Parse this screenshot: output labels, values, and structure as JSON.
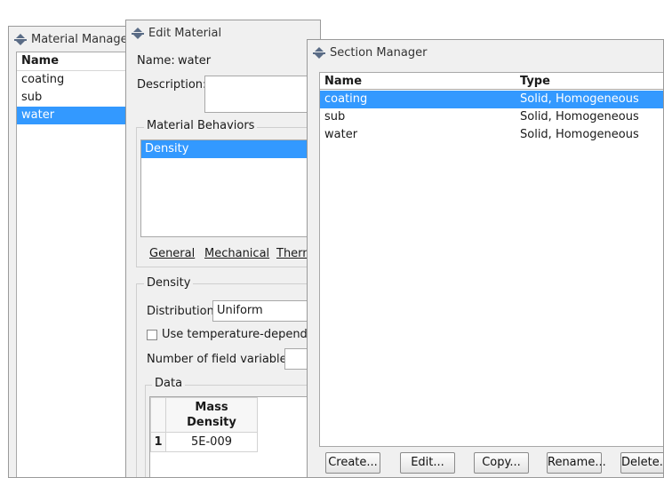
{
  "material_manager": {
    "title": "Material Manager",
    "column_name": "Name",
    "items": [
      "coating",
      "sub",
      "water"
    ],
    "selected": "water"
  },
  "edit_material": {
    "title": "Edit Material",
    "name_label": "Name:",
    "name_value": "water",
    "description_label": "Description:",
    "behaviors_group": "Material Behaviors",
    "behaviors": [
      "Density"
    ],
    "menu_tabs": [
      "General",
      "Mechanical",
      "Therm"
    ],
    "density_group": "Density",
    "distribution_label": "Distribution:",
    "distribution_value": "Uniform",
    "temp_dependent_label": "Use temperature-dependent",
    "field_vars_label": "Number of field variables:",
    "data_group": "Data",
    "table": {
      "header_line1": "Mass",
      "header_line2": "Density",
      "rows": [
        {
          "index": "1",
          "value": "5E-009"
        }
      ]
    }
  },
  "section_manager": {
    "title": "Section Manager",
    "col_name": "Name",
    "col_type": "Type",
    "rows": [
      {
        "name": "coating",
        "type": "Solid, Homogeneous"
      },
      {
        "name": "sub",
        "type": "Solid, Homogeneous"
      },
      {
        "name": "water",
        "type": "Solid, Homogeneous"
      }
    ],
    "buttons": {
      "create": "Create...",
      "edit": "Edit...",
      "copy": "Copy...",
      "rename": "Rename...",
      "delete": "Delete..."
    }
  },
  "colors": {
    "selection": "#3399ff",
    "window_bg": "#f0f0f0"
  }
}
